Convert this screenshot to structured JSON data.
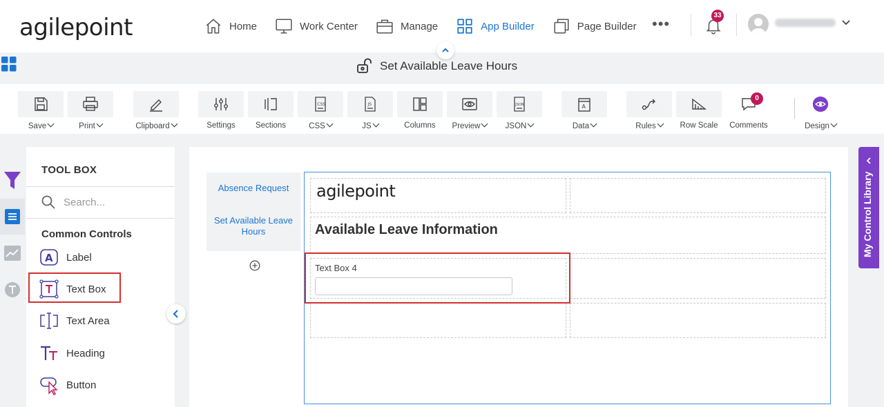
{
  "header": {
    "logo": "agilepoint",
    "nav": [
      {
        "label": "Home",
        "icon": "home-icon",
        "active": false
      },
      {
        "label": "Work Center",
        "icon": "monitor-icon",
        "active": false
      },
      {
        "label": "Manage",
        "icon": "briefcase-icon",
        "active": false
      },
      {
        "label": "App Builder",
        "icon": "grid-icon",
        "active": true
      },
      {
        "label": "Page Builder",
        "icon": "copy-icon",
        "active": false
      }
    ],
    "more": "•••",
    "notifications_count": "33"
  },
  "form_title": "Set Available Leave Hours",
  "toolbar": {
    "items": [
      {
        "label": "Save",
        "has_menu": true
      },
      {
        "label": "Print",
        "has_menu": true
      },
      {
        "label": "Clipboard",
        "has_menu": true
      },
      {
        "label": "Settings",
        "has_menu": false
      },
      {
        "label": "Sections",
        "has_menu": false
      },
      {
        "label": "CSS",
        "has_menu": true
      },
      {
        "label": "JS",
        "has_menu": true
      },
      {
        "label": "Columns",
        "has_menu": false
      },
      {
        "label": "Preview",
        "has_menu": true
      },
      {
        "label": "JSON",
        "has_menu": true
      },
      {
        "label": "Data",
        "has_menu": true
      },
      {
        "label": "Rules",
        "has_menu": true
      },
      {
        "label": "Row Scale",
        "has_menu": false
      },
      {
        "label": "Comments",
        "has_menu": false
      },
      {
        "label": "Design",
        "has_menu": true
      }
    ],
    "comments_count": "0"
  },
  "toolbox": {
    "title": "TOOL BOX",
    "search_placeholder": "Search...",
    "section": "Common Controls",
    "items": [
      {
        "label": "Label",
        "icon": "label-a-icon"
      },
      {
        "label": "Text Box",
        "icon": "text-box-icon"
      },
      {
        "label": "Text Area",
        "icon": "text-area-icon"
      },
      {
        "label": "Heading",
        "icon": "heading-icon"
      },
      {
        "label": "Button",
        "icon": "button-cursor-icon"
      }
    ]
  },
  "pages": [
    {
      "label": "Absence Request",
      "active": false
    },
    {
      "label": "Set Available Leave Hours",
      "active": true
    }
  ],
  "form": {
    "logo": "agilepoint",
    "heading": "Available Leave Information",
    "field_label": "Text Box 4",
    "field_value": ""
  },
  "my_control_library": "My Control Library",
  "colors": {
    "accent": "#1976d2",
    "highlight": "#d32f2f",
    "badge": "#c2185b",
    "library": "#7b3fc8"
  }
}
